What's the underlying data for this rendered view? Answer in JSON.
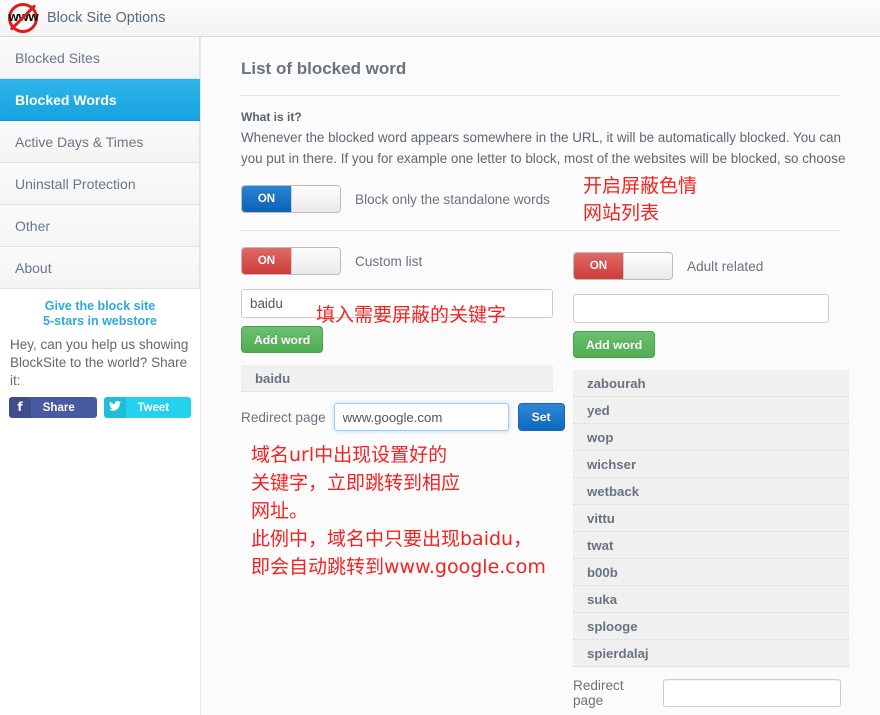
{
  "header": {
    "title": "Block Site Options",
    "logo_text": "WWW",
    "logo_icon": "blocked-www-logo-icon"
  },
  "sidebar": {
    "items": [
      {
        "label": "Blocked Sites",
        "active": false
      },
      {
        "label": "Blocked Words",
        "active": true
      },
      {
        "label": "Active Days & Times",
        "active": false
      },
      {
        "label": "Uninstall Protection",
        "active": false
      },
      {
        "label": "Other",
        "active": false
      },
      {
        "label": "About",
        "active": false
      }
    ],
    "promo": {
      "stars_line1": "Give the block site",
      "stars_line2": "5-stars in webstore",
      "blurb": "Hey, can you help us showing BlockSite to the world? Share it:",
      "facebook_label": "Share",
      "facebook_glyph": "f",
      "twitter_label": "Tweet",
      "twitter_glyph": "✉"
    }
  },
  "main": {
    "page_title": "List of blocked word",
    "intro_heading": "What is it?",
    "intro_line1": "Whenever the blocked word appears somewhere in the URL, it will be automatically blocked. You can",
    "intro_line2": "you put in there. If you for example one letter to block, most of the websites will be blocked, so choose",
    "standalone": {
      "toggle_state": "ON",
      "label": "Block only the standalone words"
    },
    "custom_list": {
      "toggle_state": "ON",
      "label": "Custom list",
      "input_value": "baidu",
      "input_placeholder": "",
      "add_button": "Add word",
      "words": [
        "baidu"
      ],
      "redirect_label": "Redirect page",
      "redirect_value": "www.google.com",
      "redirect_placeholder": "",
      "set_button": "Set"
    },
    "adult_related": {
      "toggle_state": "ON",
      "label": "Adult related",
      "input_value": "",
      "input_placeholder": "",
      "add_button": "Add word",
      "words": [
        "zabourah",
        "yed",
        "wop",
        "wichser",
        "wetback",
        "vittu",
        "twat",
        "b00b",
        "suka",
        "splooge",
        "spierdalaj"
      ],
      "redirect_label": "Redirect page",
      "redirect_value": "",
      "redirect_placeholder": ""
    }
  },
  "annotations": {
    "color": "#f42222",
    "adult_toggle": "开启屏蔽色情\n网站列表",
    "keyword_input": "填入需要屏蔽的关键字",
    "redirect_cn_1": "域名url中出现设置好的\n关键字，立即跳转到相应\n网址。\n此例中，域名中只要出现baidu，\n即会自动跳转到www.google.com"
  }
}
